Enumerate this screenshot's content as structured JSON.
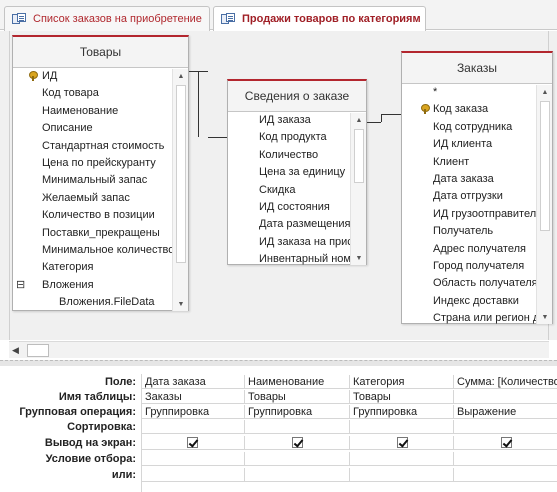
{
  "tabs": [
    {
      "label": "Список заказов на приобретение",
      "active": false,
      "icon": "query-icon"
    },
    {
      "label": "Продажи товаров по категориям",
      "active": true,
      "icon": "query-icon"
    }
  ],
  "tables": {
    "tovary": {
      "title": "Товары",
      "fields": [
        "ИД",
        "Код товара",
        "Наименование",
        "Описание",
        "Стандартная стоимость",
        "Цена по прейскуранту",
        "Минимальный запас",
        "Желаемый запас",
        "Количество в позиции",
        "Поставки_прекращены",
        "Минимальное количество",
        "Категория",
        "Вложения",
        "Вложения.FileData"
      ],
      "key_field": "ИД",
      "expand_symbol": "⊟"
    },
    "svedeniya": {
      "title": "Сведения о заказе",
      "fields": [
        "ИД заказа",
        "Код продукта",
        "Количество",
        "Цена за единицу",
        "Скидка",
        "ИД состояния",
        "Дата размещения",
        "ИД заказа на прис",
        "Инвентарный ном"
      ]
    },
    "zakazy": {
      "title": "Заказы",
      "fields": [
        "*",
        "Код заказа",
        "Код сотрудника",
        "ИД клиента",
        "Клиент",
        "Дата заказа",
        "Дата отгрузки",
        "ИД грузоотправител",
        "Получатель",
        "Адрес получателя",
        "Город получателя",
        "Область получателя",
        "Индекс доставки",
        "Страна или регион д"
      ],
      "key_field": "Код заказа"
    }
  },
  "grid": {
    "row_labels": [
      "Поле:",
      "Имя таблицы:",
      "Групповая операция:",
      "Сортировка:",
      "Вывод на экран:",
      "Условие отбора:",
      "или:"
    ],
    "columns": [
      {
        "field": "Дата заказа",
        "table": "Заказы",
        "total": "Группировка",
        "sort": "",
        "show": true
      },
      {
        "field": "Наименование",
        "table": "Товары",
        "total": "Группировка",
        "sort": "",
        "show": true
      },
      {
        "field": "Категория",
        "table": "Товары",
        "total": "Группировка",
        "sort": "",
        "show": true
      },
      {
        "field": "Сумма: [Количество",
        "table": "",
        "total": "Выражение",
        "sort": "",
        "show": true
      }
    ]
  },
  "colors": {
    "accent": "#b3262e",
    "tab_text": "#a01f26"
  }
}
